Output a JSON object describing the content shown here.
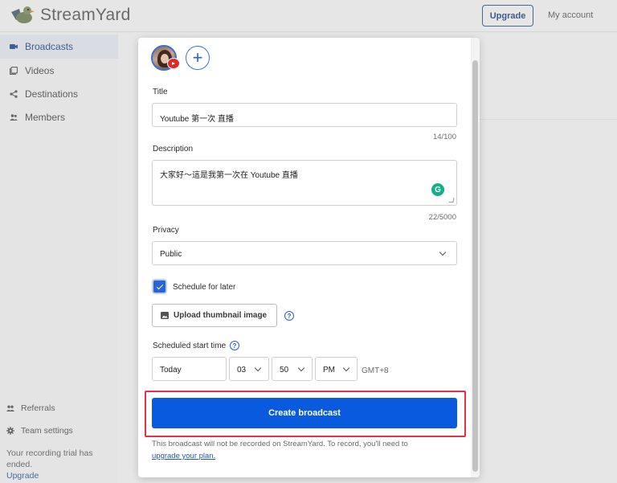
{
  "app": {
    "brand": "StreamYard",
    "header": {
      "upgrade_label": "Upgrade",
      "account_label": "My account"
    },
    "sidebar": {
      "items": [
        {
          "label": "Broadcasts",
          "icon": "broadcast-icon",
          "active": true
        },
        {
          "label": "Videos",
          "icon": "videos-icon",
          "active": false
        },
        {
          "label": "Destinations",
          "icon": "share-icon",
          "active": false
        },
        {
          "label": "Members",
          "icon": "members-icon",
          "active": false
        }
      ],
      "footer": [
        {
          "label": "Referrals",
          "icon": "referrals-icon"
        },
        {
          "label": "Team settings",
          "icon": "gear-icon"
        }
      ],
      "trial_text": "Your recording trial has ended.",
      "trial_link": "Upgrade"
    }
  },
  "modal": {
    "destination_avatar": "youtube-channel-avatar",
    "add_destination_symbol": "+",
    "title": {
      "label": "Title",
      "value": "Youtube 第一次 直播",
      "counter": "14/100"
    },
    "description": {
      "label": "Description",
      "value": "大家好～這是我第一次在 Youtube 直播",
      "counter": "22/5000",
      "grammarly_glyph": "G"
    },
    "privacy": {
      "label": "Privacy",
      "value": "Public"
    },
    "schedule": {
      "label": "Schedule for later",
      "checked": true
    },
    "upload_thumbnail_label": "Upload thumbnail image",
    "help_glyph": "?",
    "start_time": {
      "label": "Scheduled start time",
      "day": "Today",
      "hour": "03",
      "minute": "50",
      "ampm": "PM",
      "timezone": "GMT+8"
    },
    "create_label": "Create broadcast",
    "note_text": "This broadcast will not be recorded on StreamYard. To record, you'll need to",
    "note_link": "upgrade your plan."
  },
  "colors": {
    "primary": "#0a5ae0",
    "highlight_border": "#e0334b",
    "youtube_red": "#e02a2a",
    "grammarly_green": "#15b088"
  }
}
